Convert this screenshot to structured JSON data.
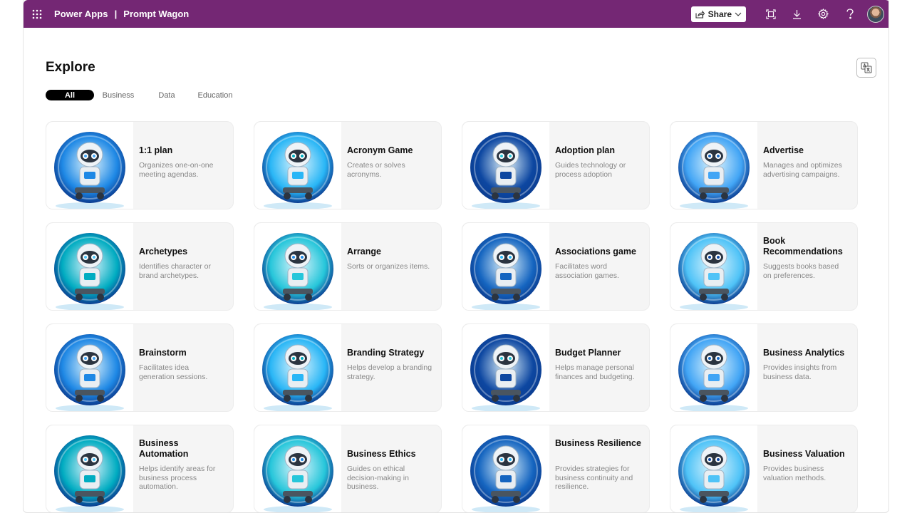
{
  "header": {
    "app_name": "Power Apps",
    "separator": "|",
    "app_title": "Prompt Wagon",
    "share_label": "Share"
  },
  "page": {
    "title": "Explore"
  },
  "tabs": [
    {
      "label": "All",
      "active": true
    },
    {
      "label": "Business",
      "active": false
    },
    {
      "label": "Data",
      "active": false
    },
    {
      "label": "Education",
      "active": false
    }
  ],
  "cards": [
    {
      "title": "1:1 plan",
      "desc": "Organizes one-on-one meeting agendas."
    },
    {
      "title": "Acronym Game",
      "desc": "Creates or solves acronyms."
    },
    {
      "title": "Adoption plan",
      "desc": "Guides technology or process adoption"
    },
    {
      "title": "Advertise",
      "desc": "Manages and optimizes advertising campaigns."
    },
    {
      "title": "Archetypes",
      "desc": "Identifies character or brand archetypes."
    },
    {
      "title": "Arrange",
      "desc": "Sorts or organizes items."
    },
    {
      "title": "Associations game",
      "desc": "Facilitates word association games."
    },
    {
      "title": "Book Recommendations",
      "desc": "Suggests books based on preferences."
    },
    {
      "title": "Brainstorm",
      "desc": "Facilitates idea generation sessions."
    },
    {
      "title": "Branding Strategy",
      "desc": "Helps develop a branding strategy."
    },
    {
      "title": "Budget Planner",
      "desc": "Helps manage personal finances and budgeting."
    },
    {
      "title": "Business Analytics",
      "desc": "Provides insights from business data."
    },
    {
      "title": "Business Automation",
      "desc": "Helps identify areas for business process automation."
    },
    {
      "title": "Business Ethics",
      "desc": "Guides on ethical decision-making in business."
    },
    {
      "title": "Business Resilience",
      "desc": "Provides strategies for business continuity and resilience."
    },
    {
      "title": "Business Valuation",
      "desc": "Provides business valuation methods."
    }
  ],
  "colors": {
    "header_bg": "#742774",
    "accent_blue": "#1e88e5"
  }
}
